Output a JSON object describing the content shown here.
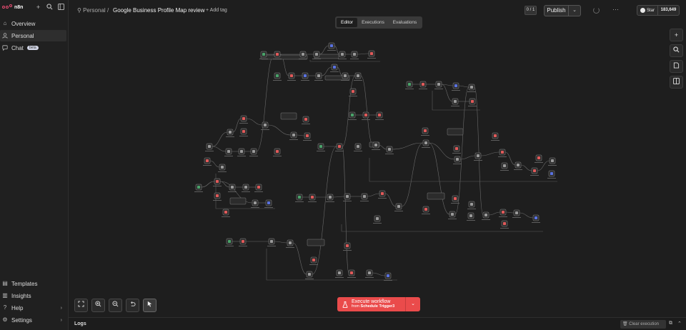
{
  "sidebar": {
    "logo_text": "n8n",
    "items": [
      {
        "label": "Overview",
        "icon": "home-icon"
      },
      {
        "label": "Personal",
        "icon": "user-icon"
      },
      {
        "label": "Chat",
        "icon": "chat-icon",
        "badge": "beta"
      }
    ],
    "bottom_items": [
      {
        "label": "Templates",
        "icon": "templates-icon"
      },
      {
        "label": "Insights",
        "icon": "insights-icon"
      },
      {
        "label": "Help",
        "icon": "help-icon"
      },
      {
        "label": "Settings",
        "icon": "settings-icon"
      }
    ]
  },
  "header": {
    "breadcrumb_project": "Personal",
    "separator": "/",
    "workflow_title": "Google Business Profile Map review",
    "add_tag": "+ Add tag",
    "counter": "0 / 1",
    "publish_label": "Publish",
    "github_star_label": "Star",
    "github_star_count": "183,649"
  },
  "tabs": [
    {
      "label": "Editor",
      "active": true
    },
    {
      "label": "Executions",
      "active": false
    },
    {
      "label": "Evaluations",
      "active": false
    }
  ],
  "execute": {
    "title": "Execute workflow",
    "subtitle_prefix": "from",
    "subtitle_node": "Schedule Trigger3"
  },
  "logs": {
    "label": "Logs",
    "clear_label": "Clear execution"
  },
  "colors": {
    "accent": "#ea4b4b",
    "brand": "#ea4b71",
    "canvas_bg": "#1e1e1e",
    "node_bg": "#2c2c2c",
    "trigger_green": "#4aa36a",
    "node_red": "#e05a5a",
    "node_blue": "#5a72e0"
  }
}
